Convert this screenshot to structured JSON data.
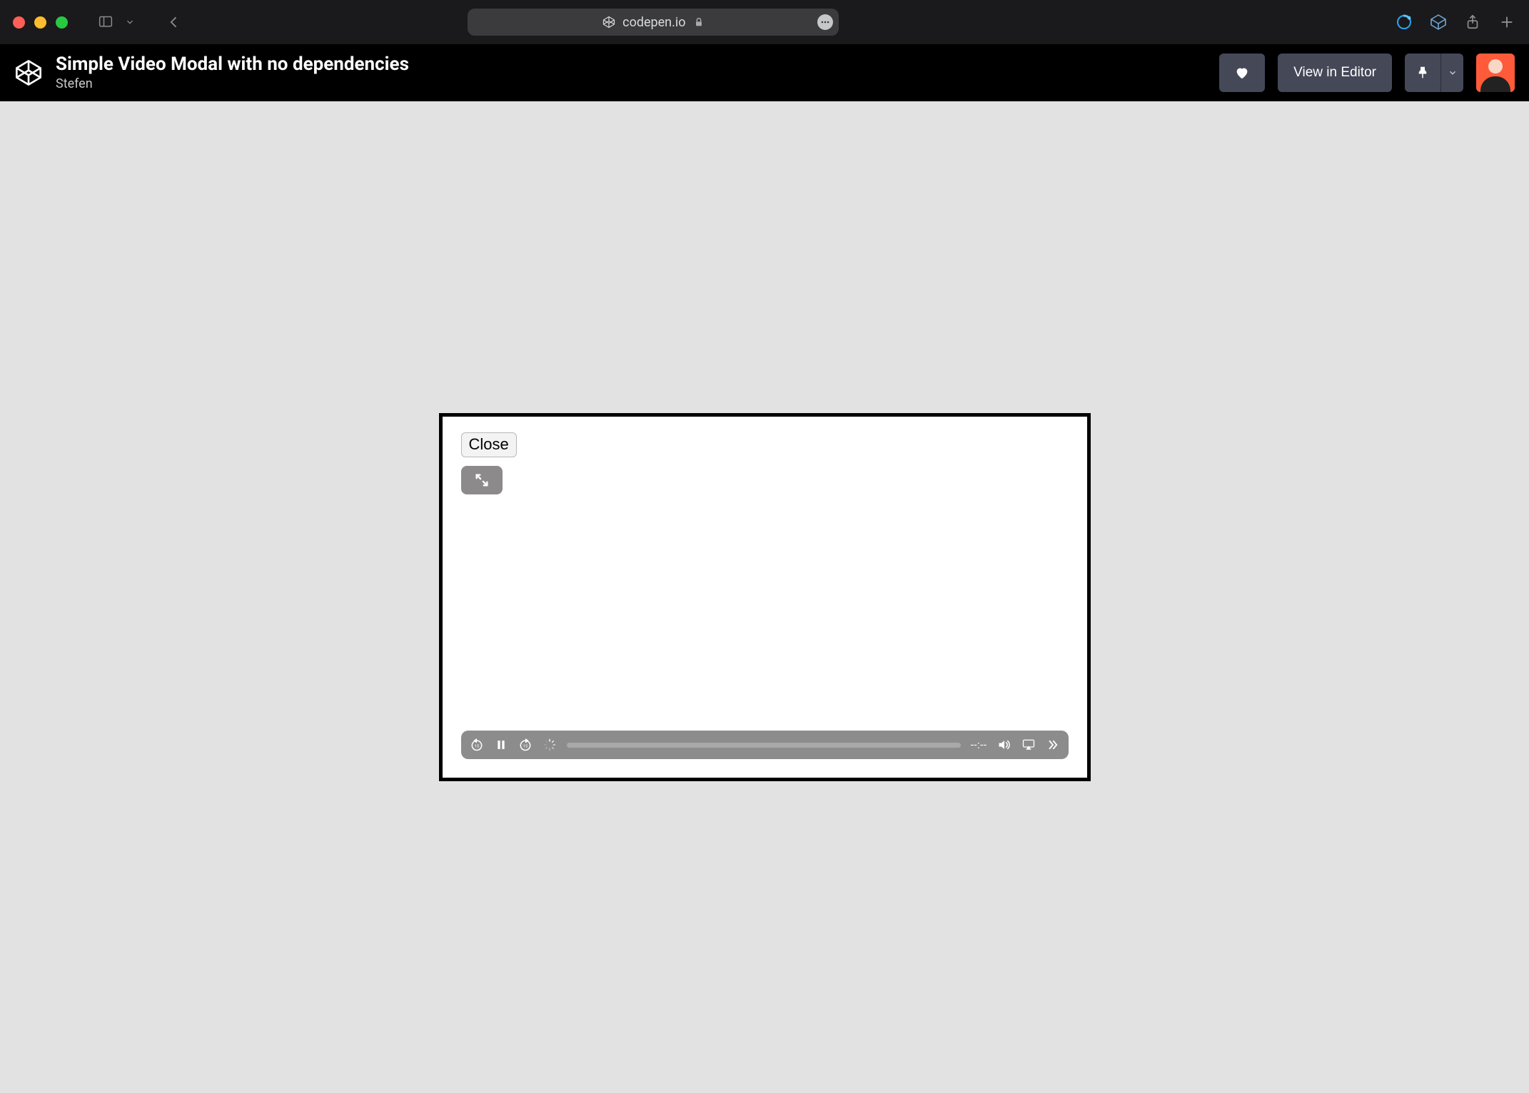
{
  "browser": {
    "domain": "codepen.io"
  },
  "codepen": {
    "title": "Simple Video Modal with no dependencies",
    "author": "Stefen",
    "view_in_editor_label": "View in Editor"
  },
  "modal": {
    "close_label": "Close"
  },
  "video": {
    "time_display": "--:--"
  }
}
